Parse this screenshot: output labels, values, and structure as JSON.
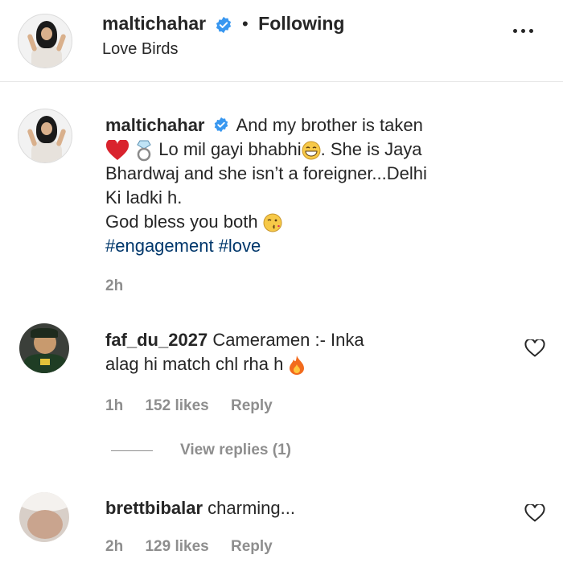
{
  "post_header": {
    "username": "maltichahar",
    "follow_status": "Following",
    "location": "Love Birds"
  },
  "caption": {
    "username": "maltichahar",
    "line1": "And my brother is taken",
    "line2": "Lo mil gayi bhabhi",
    "line2_after": ". She is Jaya",
    "line3": "Bhardwaj and she isn’t a foreigner...Delhi",
    "line4": "Ki ladki h.",
    "line5": "God bless you both",
    "hashtags": [
      "#engagement",
      "#love"
    ],
    "time": "2h"
  },
  "comments": [
    {
      "username": "faf_du_2027",
      "text_line1": "Cameramen :- Inka",
      "text_line2": "alag hi match chl rha h",
      "time": "1h",
      "likes": "152 likes",
      "reply": "Reply",
      "view_replies": "View replies (1)"
    },
    {
      "username": "brettbibalar",
      "text_line1": "charming...",
      "time": "2h",
      "likes": "129 likes",
      "reply": "Reply"
    }
  ],
  "colors": {
    "text": "#262626",
    "secondary": "#8e8e8e",
    "link": "#00376b",
    "verified": "#3897f0",
    "divider": "#e6e6e6"
  },
  "icons": [
    "verified-icon",
    "more-options-icon",
    "heart-emoji-icon",
    "ring-emoji-icon",
    "grin-emoji-icon",
    "kiss-emoji-icon",
    "fire-emoji-icon",
    "like-heart-icon"
  ]
}
